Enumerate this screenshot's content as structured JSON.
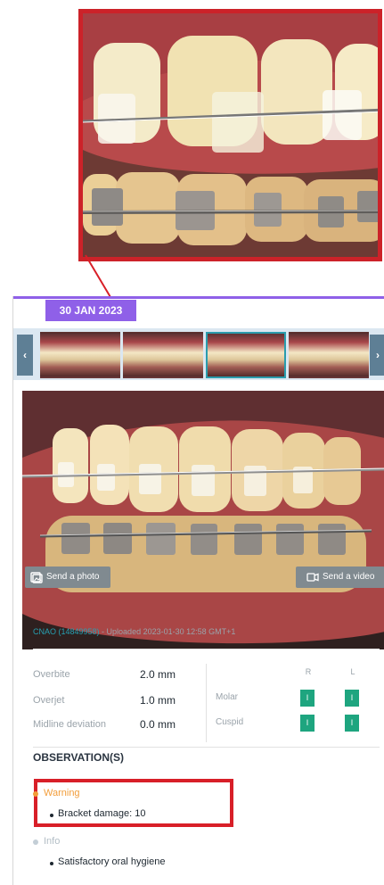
{
  "date_badge": "30 JAN 2023",
  "carousel": {
    "left_arrow": "‹",
    "right_arrow": "›"
  },
  "actions": {
    "send_photo": "Send a photo",
    "send_video": "Send a video"
  },
  "upload": {
    "id_text": "CNAO (14849958)",
    "meta_text": " - Uploaded 2023-01-30 12:58 GMT+1"
  },
  "metrics": {
    "overbite_label": "Overbite",
    "overbite_value": "2.0 mm",
    "overjet_label": "Overjet",
    "overjet_value": "1.0 mm",
    "midline_label": "Midline deviation",
    "midline_value": "0.0 mm",
    "right_header": "R",
    "left_header": "L",
    "molar_label": "Molar",
    "cuspid_label": "Cuspid",
    "molar_r": "I",
    "molar_l": "I",
    "cuspid_r": "I",
    "cuspid_l": "I"
  },
  "observations": {
    "title": "OBSERVATION(S)",
    "warning_label": "Warning",
    "warning_item": "Bracket damage: 10",
    "info_label": "Info",
    "info_item": "Satisfactory oral hygiene"
  },
  "colors": {
    "accent": "#8f60e8",
    "link": "#26a0b2",
    "green": "#1ea57f",
    "warning": "#f29d3a",
    "highlight_red": "#d81f28"
  }
}
